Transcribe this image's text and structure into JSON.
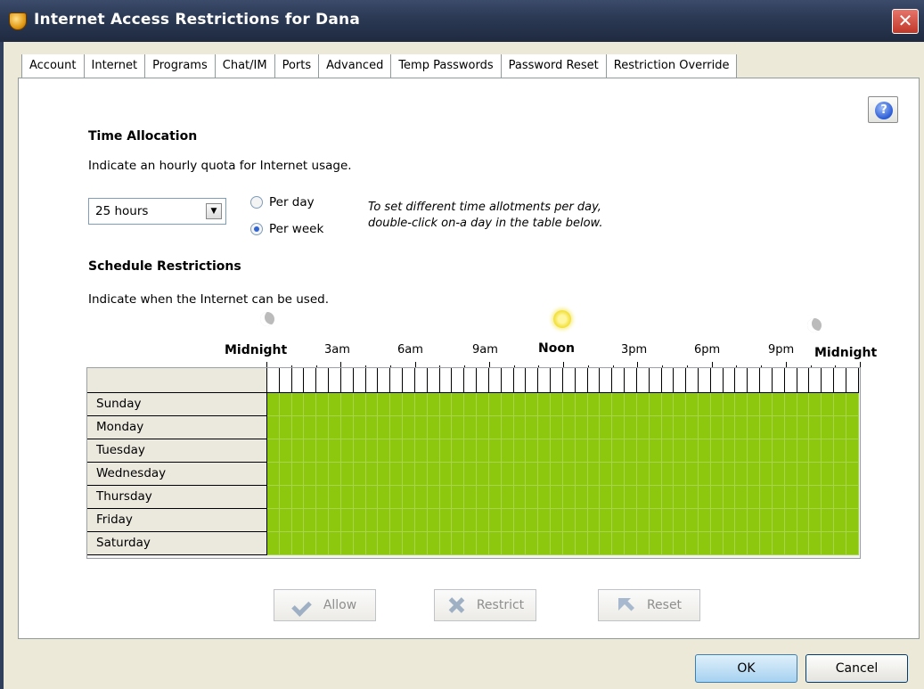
{
  "window": {
    "title": "Internet Access Restrictions for Dana",
    "close_glyph": "✕"
  },
  "tabs": [
    {
      "label": "Account"
    },
    {
      "label": "Internet"
    },
    {
      "label": "Programs"
    },
    {
      "label": "Chat/IM"
    },
    {
      "label": "Ports"
    },
    {
      "label": "Advanced"
    },
    {
      "label": "Temp Passwords"
    },
    {
      "label": "Password Reset"
    },
    {
      "label": "Restriction Override"
    }
  ],
  "active_tab": "Internet",
  "help_glyph": "?",
  "time_allocation": {
    "title": "Time Allocation",
    "description": "Indicate an hourly quota for Internet usage.",
    "quota_value": "25 hours",
    "dropdown_glyph": "▼",
    "per_day_label": "Per day",
    "per_week_label": "Per week",
    "selected_period": "Per week",
    "hint_line1": "To set different time allotments per day,",
    "hint_line2": "double-click on-a day in the table below."
  },
  "schedule": {
    "title": "Schedule Restrictions",
    "description": "Indicate when the Internet can be used.",
    "time_labels": [
      "Midnight",
      "3am",
      "6am",
      "9am",
      "Noon",
      "3pm",
      "6pm",
      "9pm",
      "Midnight"
    ],
    "days": [
      "Sunday",
      "Monday",
      "Tuesday",
      "Wednesday",
      "Thursday",
      "Friday",
      "Saturday"
    ],
    "allowed_color": "#8dc80e"
  },
  "actions": {
    "allow_label": "Allow",
    "restrict_label": "Restrict",
    "reset_label": "Reset"
  },
  "dialog_buttons": {
    "ok_label": "OK",
    "cancel_label": "Cancel"
  }
}
